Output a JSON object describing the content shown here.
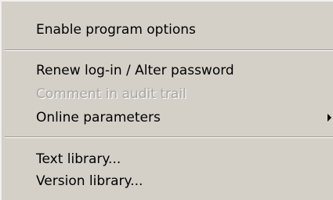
{
  "menu": {
    "items": [
      {
        "label": "Enable program options",
        "enabled": true
      },
      {
        "label": "Renew log-in / Alter password",
        "enabled": true
      },
      {
        "label": "Comment in audit trail",
        "enabled": false
      },
      {
        "label": "Online parameters",
        "enabled": true,
        "submenu_icon": "submenu-arrow-icon"
      },
      {
        "label": "Text library...",
        "enabled": true
      },
      {
        "label": "Version library...",
        "enabled": true
      }
    ]
  },
  "colors": {
    "menu_background": "#d4d0c8",
    "disabled_text": "#a9a6a0",
    "separator_shadow": "#a09c94"
  }
}
